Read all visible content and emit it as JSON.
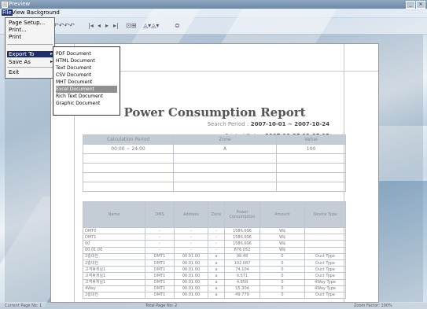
{
  "window": {
    "title": "Preview"
  },
  "menubar": [
    "File",
    "View",
    "Background"
  ],
  "file_menu": {
    "items": [
      "Page Setup...",
      "Print...",
      "Print",
      "Export To",
      "Save As",
      "Exit"
    ],
    "highlighted": "Export To"
  },
  "export_submenu": {
    "items": [
      "PDF Document",
      "HTML Document",
      "Text Document",
      "CSV Document",
      "MHT Document",
      "Excel Document",
      "Rich Text Document",
      "Graphic Document"
    ],
    "highlighted": "Excel Document"
  },
  "report": {
    "title": "Power Consumption Report",
    "search_period_label": "Search Period :",
    "search_period_value": "2007-10-01 ~ 2007-10-24",
    "printed_date_label": "Printed Date :",
    "printed_date_value": "2007-10-25 09:05:15",
    "summary_headers": [
      "Calculation Period",
      "Zone",
      "Value"
    ],
    "summary_row": [
      "00:00 ~ 24:00",
      "A",
      "100"
    ],
    "detail_headers": [
      "Name",
      "DMS",
      "Address",
      "Zone",
      "Power Consumption",
      "Amount",
      "Device Type"
    ],
    "detail_rows": [
      [
        "DMT0",
        "-",
        "-",
        "-",
        "1586.696",
        "W$",
        ""
      ],
      [
        "DMT1",
        "-",
        "-",
        "-",
        "1586.696",
        "W$",
        ""
      ],
      [
        "00",
        "-",
        "-",
        "-",
        "1586.696",
        "W$",
        ""
      ],
      [
        "00.01.00",
        "-",
        "-",
        "-",
        "876.052",
        "W$",
        ""
      ],
      [
        "2층대전",
        "DMT1",
        "00.01.00",
        "a",
        "98.48",
        "0",
        "Duct Type"
      ],
      [
        "2층대전",
        "DMT1",
        "00.01.00",
        "a",
        "102.087",
        "0",
        "Duct Type"
      ],
      [
        "고객휴게실1",
        "DMT1",
        "00.01.00",
        "a",
        "74.104",
        "0",
        "Duct Type"
      ],
      [
        "고객휴게실1",
        "DMT1",
        "00.01.00",
        "a",
        "0.571",
        "0",
        "Duct Type"
      ],
      [
        "고객휴게실1",
        "DMT1",
        "00.01.00",
        "a",
        "4.858",
        "0",
        "4Way Type"
      ],
      [
        "4Way",
        "DMT1",
        "00.01.00",
        "a",
        "15.304",
        "0",
        "4Way Type"
      ],
      [
        "2층대전",
        "DMT1",
        "00.01.00",
        "a",
        "49.779",
        "0",
        "Duct Type"
      ]
    ]
  },
  "status": {
    "current_page": "Current Page No: 1",
    "total_page": "Total Page No: 2",
    "zoom": "Zoom Factor: 100%"
  }
}
